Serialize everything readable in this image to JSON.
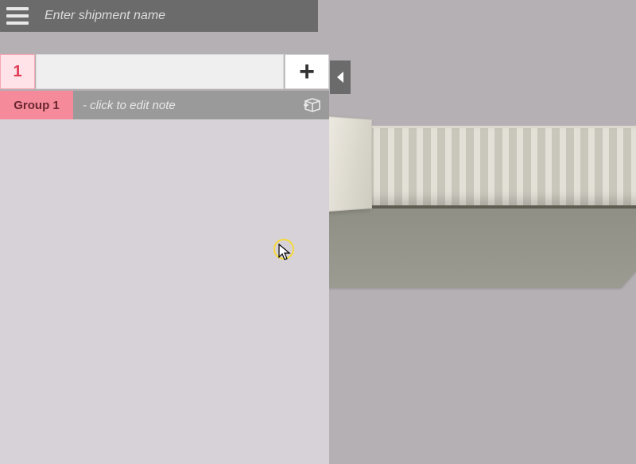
{
  "header": {
    "shipment_placeholder": "Enter shipment name"
  },
  "tabs": {
    "active_label": "1",
    "add_label": "+"
  },
  "group": {
    "label": "Group 1",
    "note_placeholder": "- click to edit note"
  },
  "icons": {
    "hamburger": "menu-icon",
    "collapse": "collapse-left-icon",
    "add_box": "add-box-icon"
  }
}
